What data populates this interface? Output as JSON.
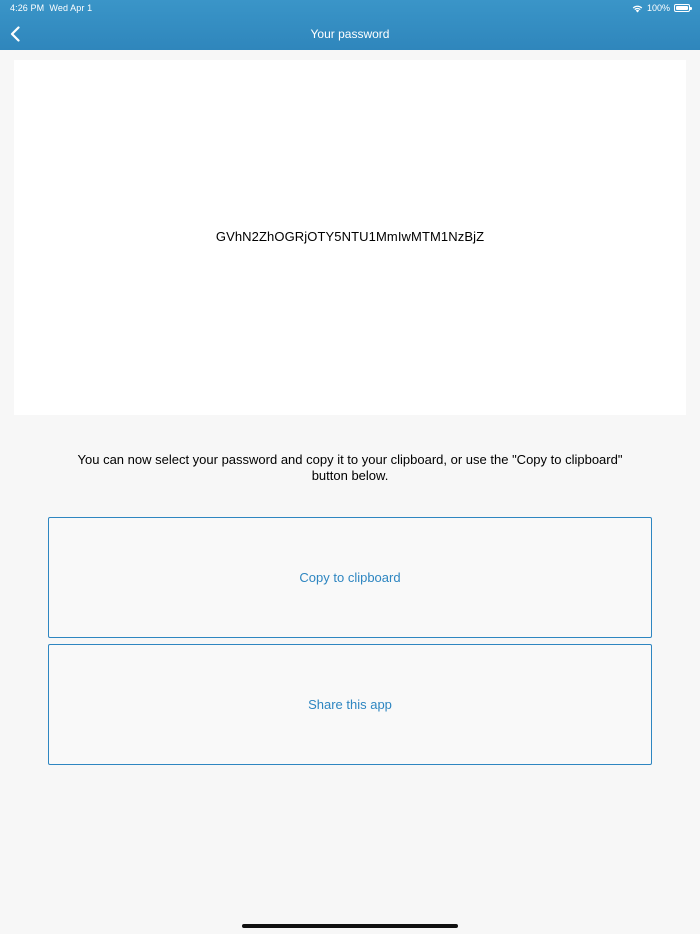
{
  "status_bar": {
    "time": "4:26 PM",
    "date": "Wed Apr 1",
    "battery": "100%",
    "icons": [
      "wifi-icon",
      "battery-icon"
    ]
  },
  "nav": {
    "title": "Your password",
    "back_icon": "chevron-left-icon"
  },
  "password": {
    "value": "GVhN2ZhOGRjOTY5NTU1MmIwMTM1NzBjZ"
  },
  "instruction": "You can now select your password and copy it to your clipboard, or use the \"Copy to clipboard\" button below.",
  "buttons": {
    "copy_label": "Copy to clipboard",
    "share_label": "Share this app"
  },
  "colors": {
    "nav_bar": "#3a95c8",
    "accent": "#2e86c1",
    "background": "#f7f7f7",
    "card": "#ffffff"
  }
}
